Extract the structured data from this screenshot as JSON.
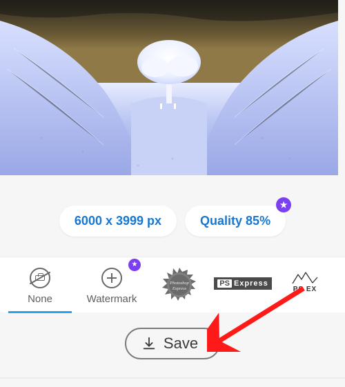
{
  "pills": {
    "size_label": "6000 x 3999 px",
    "quality_label": "Quality 85%"
  },
  "watermark_tabs": {
    "none_label": "None",
    "watermark_label": "Watermark",
    "seal_text": "Photoshop Express",
    "psx_ps": "PS",
    "psx_express": "Express",
    "psx2_label": "PS EX"
  },
  "save_label": "Save",
  "colors": {
    "accent_blue": "#1777d1",
    "select_blue": "#2aa3ef",
    "premium_purple": "#7a3ff0"
  }
}
